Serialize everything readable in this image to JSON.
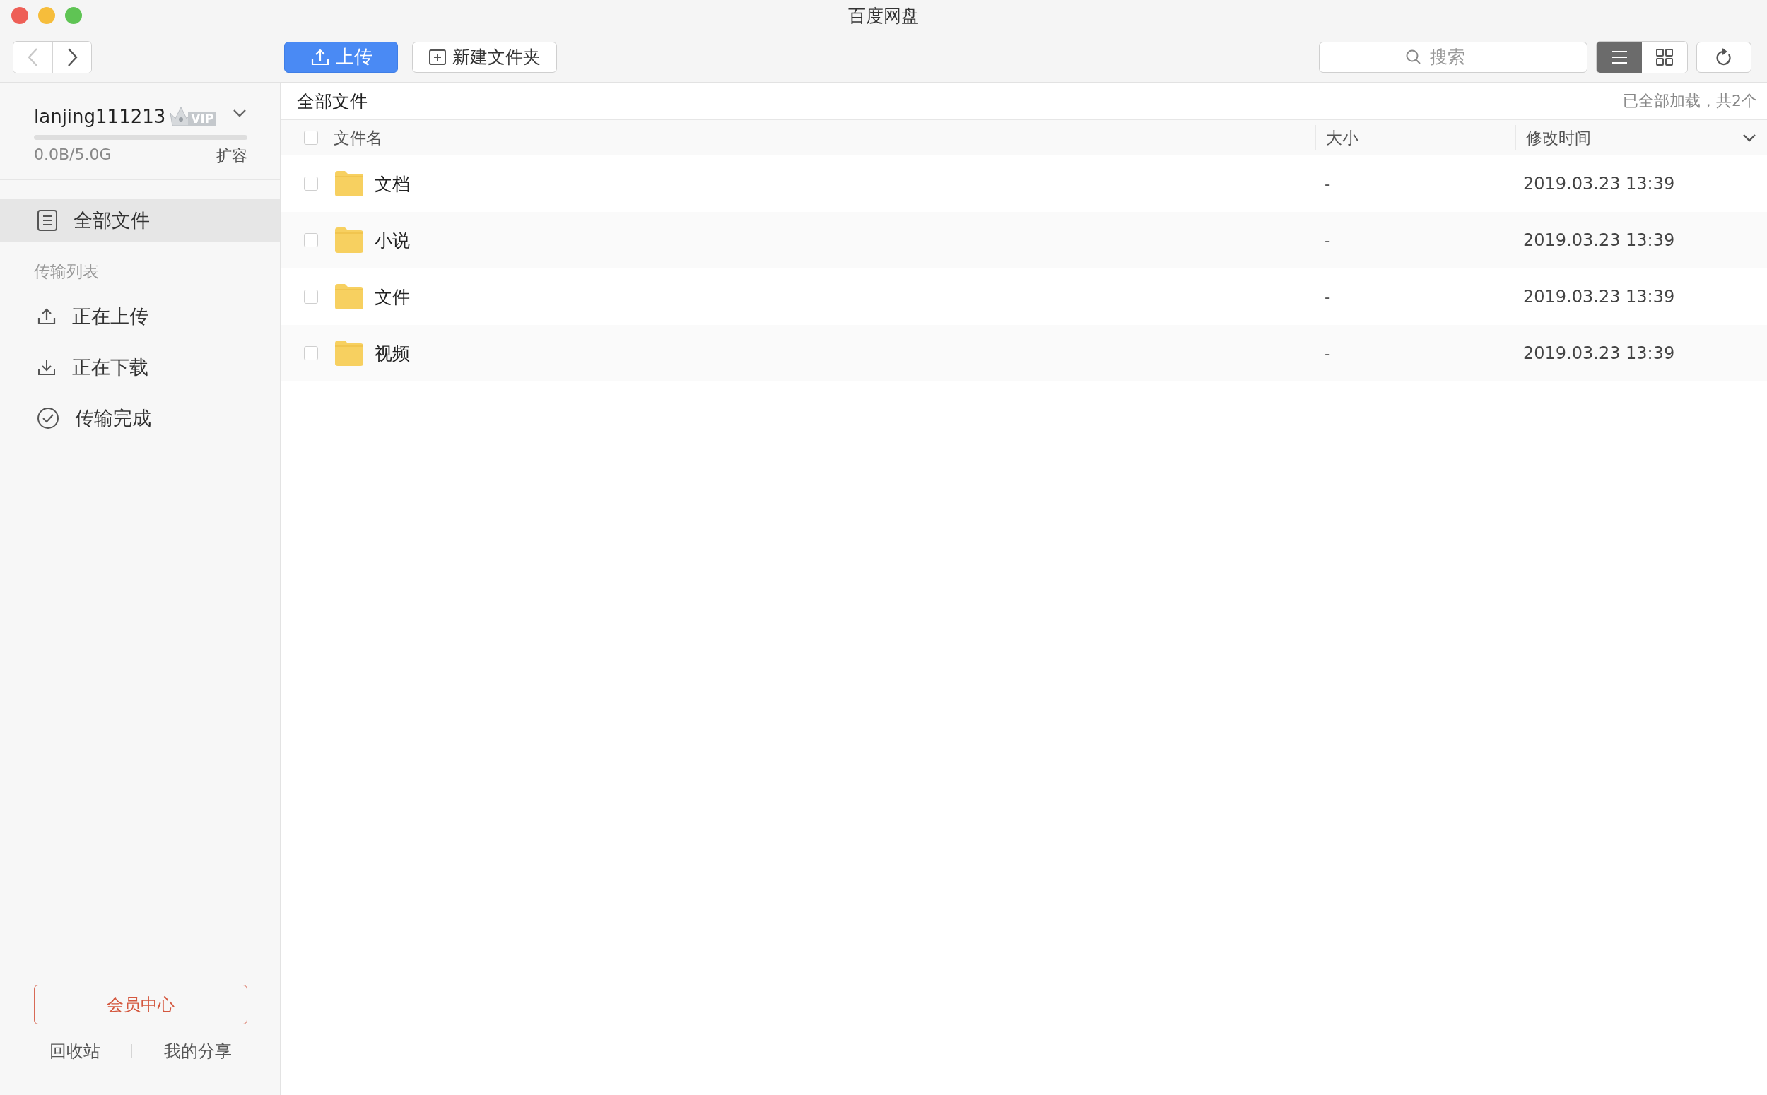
{
  "window": {
    "title": "百度网盘"
  },
  "toolbar": {
    "back": {
      "disabled": true
    },
    "forward": {
      "disabled": false
    },
    "upload_button": "上传",
    "new_folder_button": "新建文件夹",
    "search": {
      "placeholder": "搜索"
    },
    "view_modes": [
      {
        "kind": "list",
        "selected": true
      },
      {
        "kind": "grid",
        "selected": false
      }
    ]
  },
  "account": {
    "username": "lanjing111213",
    "badge": "VIP",
    "level": 0,
    "storage": "0.0B/5.0G",
    "expand": "扩容"
  },
  "sidebar": {
    "items": [
      {
        "kind": "files",
        "label": "全部文件",
        "selected": true
      }
    ],
    "section": "传输列表",
    "transfer_items": [
      {
        "kind": "upload",
        "label": "正在上传",
        "selected": false
      },
      {
        "kind": "download",
        "label": "正在下载",
        "selected": false
      },
      {
        "kind": "done",
        "label": "传输完成",
        "selected": false
      }
    ],
    "member_button": "会员中心",
    "footer_links": [
      "回收站",
      "我的分享"
    ]
  },
  "breadcrumb": "全部文件",
  "status": "已全部加载，共2个",
  "table": {
    "select_all": {
      "checked": false
    },
    "columns": [
      "文件名",
      "大小",
      "修改时间"
    ],
    "rows": [
      {
        "name": "文档",
        "size": "-",
        "modified": "2019.03.23 13:39",
        "checked": false
      },
      {
        "name": "小说",
        "size": "-",
        "modified": "2019.03.23 13:39",
        "checked": false
      },
      {
        "name": "文件",
        "size": "-",
        "modified": "2019.03.23 13:39",
        "checked": false
      },
      {
        "name": "视频",
        "size": "-",
        "modified": "2019.03.23 13:39",
        "checked": false
      }
    ]
  }
}
